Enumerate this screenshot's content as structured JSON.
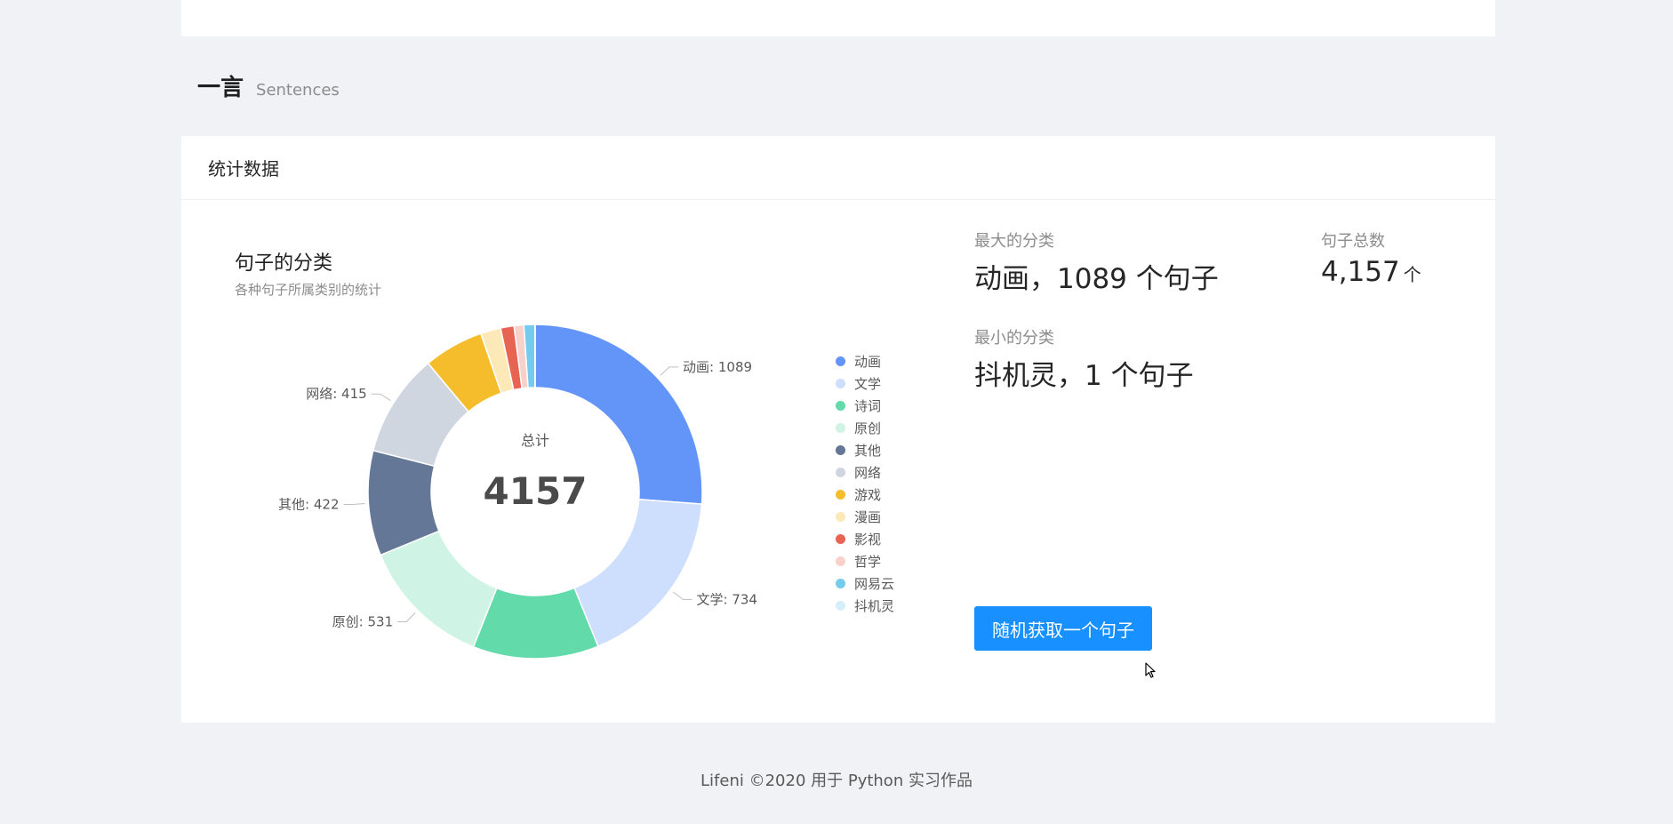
{
  "page": {
    "title": "一言",
    "subtitle": "Sentences"
  },
  "card": {
    "title": "统计数据"
  },
  "chart_data": {
    "type": "pie",
    "title": "句子的分类",
    "subtitle": "各种句子所属类别的统计",
    "center_label": "总计",
    "center_value": "4157",
    "categories": [
      "动画",
      "文学",
      "诗词",
      "原创",
      "其他",
      "网络",
      "游戏",
      "漫画",
      "影视",
      "哲学",
      "网易云",
      "抖机灵"
    ],
    "values": [
      1089,
      734,
      506,
      531,
      422,
      415,
      241,
      81,
      54,
      39,
      44,
      1
    ],
    "colors": [
      "#6395f9",
      "#cddffd",
      "#62daaa",
      "#cff3e4",
      "#657797",
      "#d0d6e0",
      "#f5bd2b",
      "#fde9b8",
      "#e86452",
      "#f9d1cb",
      "#74cbed",
      "#d6eef9"
    ],
    "labels": [
      {
        "category": "动画",
        "text": "动画: 1089"
      },
      {
        "category": "文学",
        "text": "文学: 734"
      },
      {
        "category": "原创",
        "text": "原创: 531"
      },
      {
        "category": "其他",
        "text": "其他: 422"
      },
      {
        "category": "网络",
        "text": "网络: 415"
      }
    ],
    "legend_position": "right"
  },
  "stats": {
    "max_label": "最大的分类",
    "max_value": "动画，1089 个句子",
    "total_label": "句子总数",
    "total_value": "4,157",
    "total_unit": "个",
    "min_label": "最小的分类",
    "min_value": "抖机灵，1 个句子"
  },
  "actions": {
    "random_button": "随机获取一个句子"
  },
  "footer": {
    "text": "Lifeni ©2020 用于 Python 实习作品"
  },
  "icons": {
    "cursor": "mouse-pointer-icon"
  }
}
